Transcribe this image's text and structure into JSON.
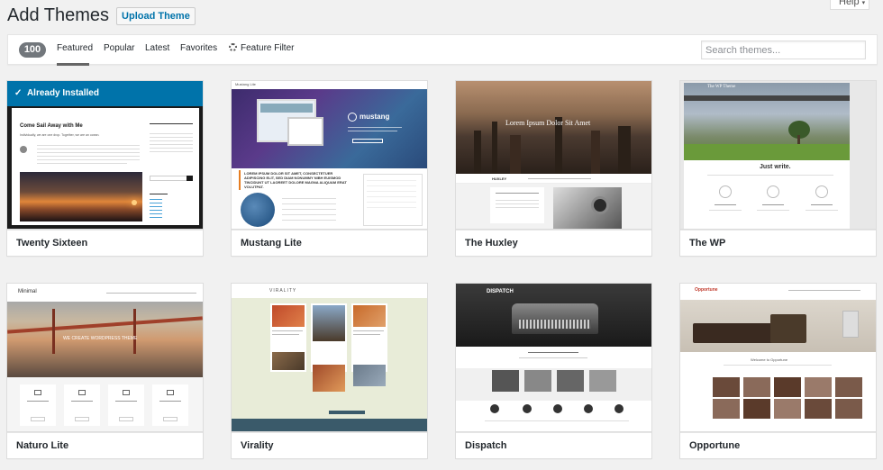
{
  "header": {
    "title": "Add Themes",
    "upload_button": "Upload Theme",
    "help_tab": "Help"
  },
  "filter_bar": {
    "count": "100",
    "tabs": [
      {
        "label": "Featured",
        "current": true
      },
      {
        "label": "Popular",
        "current": false
      },
      {
        "label": "Latest",
        "current": false
      },
      {
        "label": "Favorites",
        "current": false
      }
    ],
    "feature_filter": "Feature Filter",
    "search_placeholder": "Search themes..."
  },
  "themes": [
    {
      "name": "Twenty Sixteen",
      "installed_label": "Already Installed",
      "preview_heading": "Come Sail Away with Me",
      "preview_subheading": "Individually, we are one drop. Together, we are an ocean."
    },
    {
      "name": "Mustang Lite",
      "preview_logo": "mustang",
      "preview_site": "Mustang Lite"
    },
    {
      "name": "The Huxley",
      "preview_heading": "Lorem Ipsum Dolor Sit Amet",
      "preview_logo": "HUXLEY"
    },
    {
      "name": "The WP",
      "preview_logo": "The WP Theme",
      "preview_heading": "Just write."
    },
    {
      "name": "Naturo Lite",
      "preview_logo": "Minimal",
      "preview_heading": "WE CREATE WORDPRESS THEME"
    },
    {
      "name": "Virality",
      "preview_logo": "VIRALITY"
    },
    {
      "name": "Dispatch",
      "preview_logo": "DISPATCH"
    },
    {
      "name": "Opportune",
      "preview_logo": "Opportune",
      "preview_heading": "Welcome to Opportune"
    }
  ],
  "colors": {
    "installed": "#0073aa",
    "badge": "#72777c",
    "link": "#0073aa"
  }
}
